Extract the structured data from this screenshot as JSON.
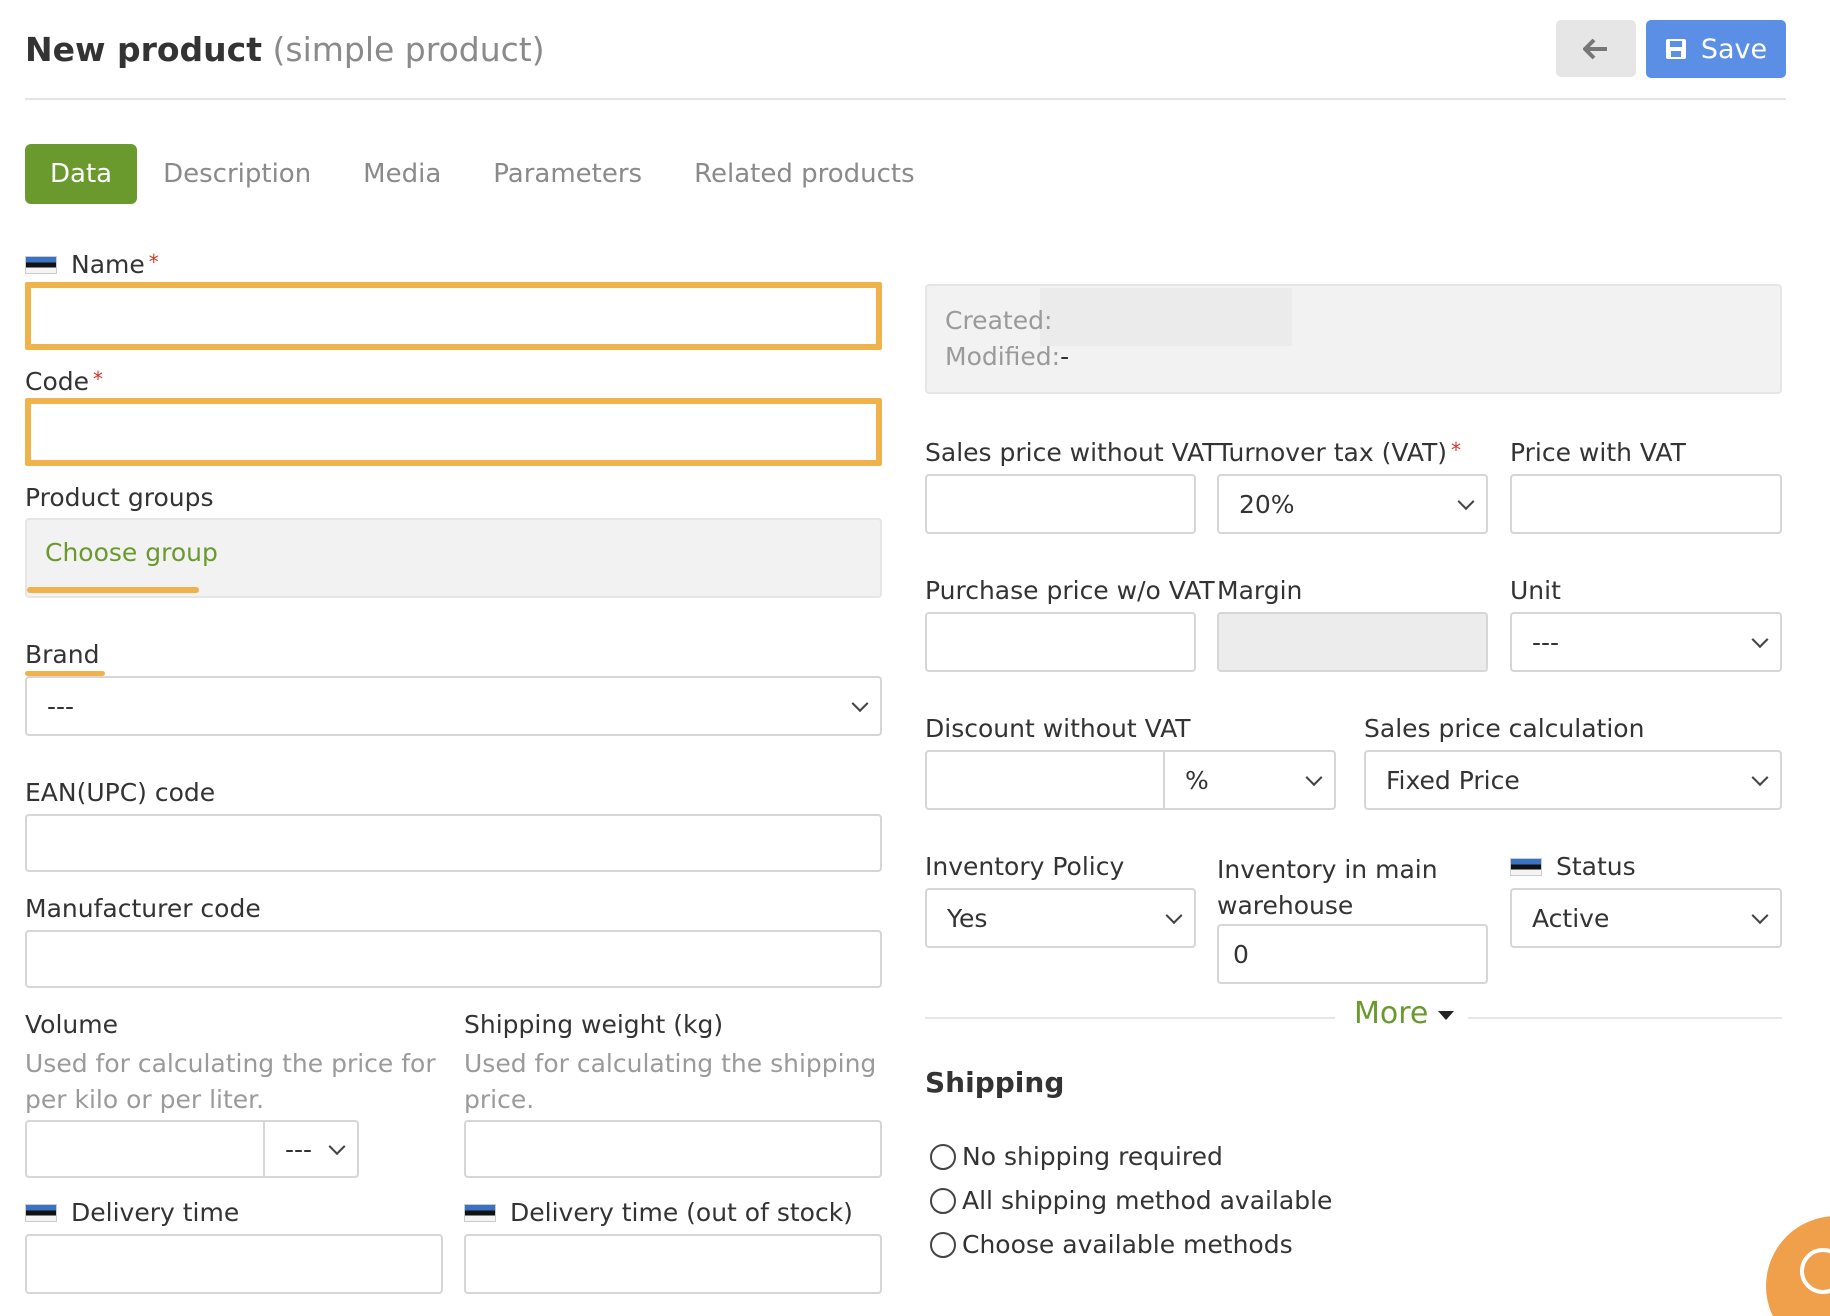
{
  "header": {
    "title": "New product",
    "subtitle": "(simple product)",
    "back_icon": "arrow-left-icon",
    "save_label": "Save",
    "save_icon": "floppy-disk-icon"
  },
  "tabs": [
    {
      "label": "Data",
      "active": true
    },
    {
      "label": "Description",
      "active": false
    },
    {
      "label": "Media",
      "active": false
    },
    {
      "label": "Parameters",
      "active": false
    },
    {
      "label": "Related products",
      "active": false
    }
  ],
  "left": {
    "name_label": "Name",
    "name_value": "",
    "code_label": "Code",
    "code_value": "",
    "product_groups_label": "Product groups",
    "choose_group": "Choose group",
    "brand_label": "Brand",
    "brand_value": "---",
    "ean_label": "EAN(UPC) code",
    "manufacturer_label": "Manufacturer code",
    "volume_label": "Volume",
    "volume_hint": "Used for calculating the price for per kilo or per liter.",
    "volume_unit": "---",
    "shipping_weight_label": "Shipping weight (kg)",
    "shipping_weight_hint": "Used for calculating the shipping price.",
    "delivery_label": "Delivery time",
    "delivery_oos_label": "Delivery time (out of stock)"
  },
  "right": {
    "created_label": "Created:",
    "modified_label": "Modified:",
    "modified_value": "-",
    "sales_price_label": "Sales price without VAT",
    "vat_label": "Turnover tax (VAT)",
    "vat_value": "20%",
    "price_vat_label": "Price with VAT",
    "purchase_label": "Purchase price w/o VAT",
    "margin_label": "Margin",
    "unit_label": "Unit",
    "unit_value": "---",
    "discount_label": "Discount without VAT",
    "discount_unit": "%",
    "sales_calc_label": "Sales price calculation",
    "sales_calc_value": "Fixed Price",
    "inventory_policy_label": "Inventory Policy",
    "inventory_policy_value": "Yes",
    "inventory_main_label": "Inventory in main warehouse",
    "inventory_main_value": "0",
    "status_label": "Status",
    "status_value": "Active",
    "more_label": "More"
  },
  "shipping": {
    "title": "Shipping",
    "options": [
      "No shipping required",
      "All shipping method available",
      "Choose available methods"
    ]
  },
  "colors": {
    "accent_green": "#6a9a2e",
    "save_blue": "#5b8fe6",
    "highlight_orange": "#f0b24a"
  }
}
